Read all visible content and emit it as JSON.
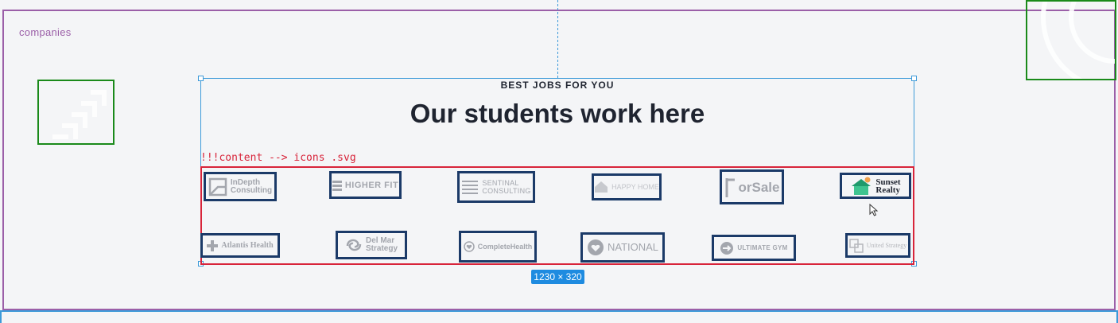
{
  "section_label": "companies",
  "eyebrow": "BEST JOBS FOR YOU",
  "heading": "Our students work here",
  "content_note": "!!!content --> icons .svg",
  "size_badge": "1230 × 320",
  "colors": {
    "accent_blue": "#1e8be0",
    "frame_purple": "#9b5fa8",
    "frame_green": "#1a8a1a",
    "frame_red": "#d8243a",
    "logo_border": "#1b3a68"
  },
  "logos": [
    {
      "name": "InDepth Consulting",
      "line1": "InDepth",
      "line2": "Consulting",
      "icon": "square-corner-icon"
    },
    {
      "name": "HIGHER FIT",
      "line1": "HIGHER FIT",
      "icon": "stripes-icon"
    },
    {
      "name": "SENTINAL CONSULTING",
      "line1": "SENTINAL",
      "line2": "CONSULTING",
      "icon": "waves-icon"
    },
    {
      "name": "HAPPY HOME",
      "line1": "HAPPY HOME",
      "icon": "house-icon"
    },
    {
      "name": "forSale",
      "line1": "orSale",
      "icon": "sign-post-icon"
    },
    {
      "name": "Sunset Realty",
      "line1": "Sunset",
      "line2": "Realty",
      "icon": "green-house-icon"
    },
    {
      "name": "Atlantis Health",
      "line1": "Atlantis Health",
      "icon": "cross-icon"
    },
    {
      "name": "Del Mar Strategy",
      "line1": "Del Mar",
      "line2": "Strategy",
      "icon": "swirl-icon"
    },
    {
      "name": "CompleteHealth",
      "line1": "CompleteHealth",
      "icon": "heart-circle-icon"
    },
    {
      "name": "NATIONAL",
      "line1": "NATIONAL",
      "icon": "heart-badge-icon"
    },
    {
      "name": "ULTIMATE GYM",
      "line1": "ULTIMATE GYM",
      "icon": "circle-arrow-icon"
    },
    {
      "name": "United Strategy",
      "line1": "United Strategy",
      "icon": "overlap-squares-icon"
    }
  ]
}
